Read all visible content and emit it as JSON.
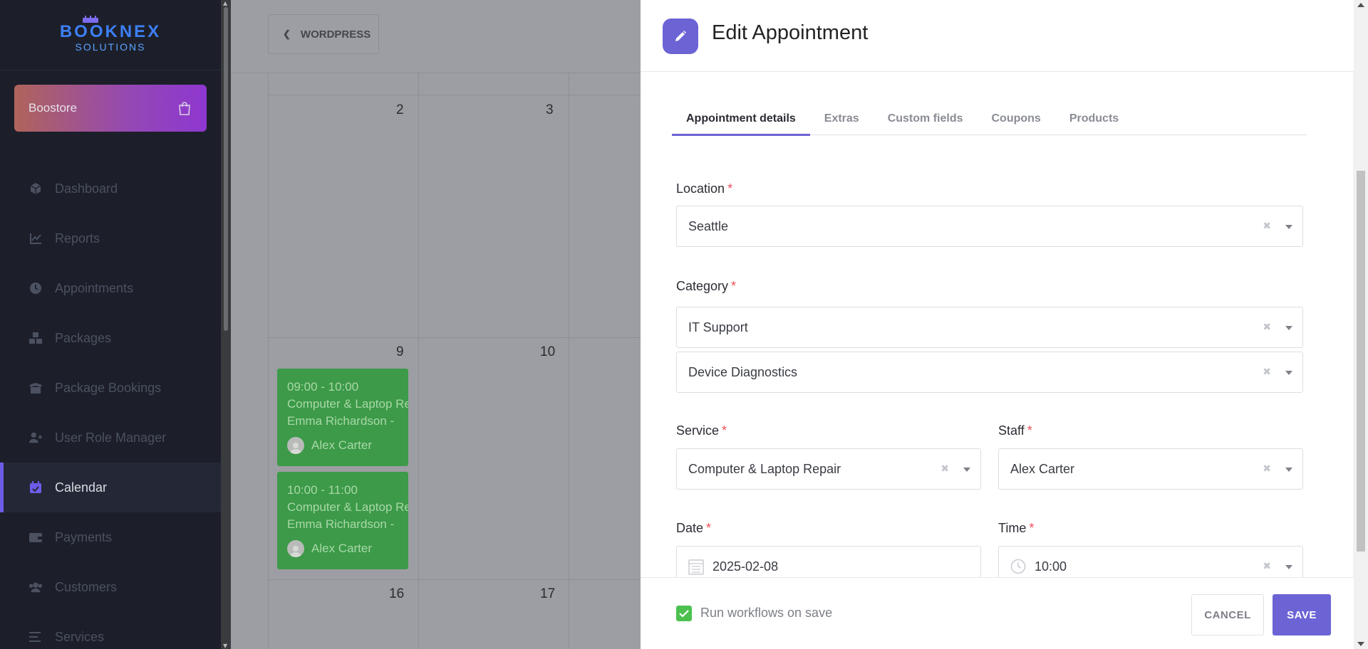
{
  "brand": {
    "name": "BOOKNEX",
    "tagline": "SOLUTIONS"
  },
  "boostore": {
    "label": "Boostore",
    "icon": "shopping-bag-icon"
  },
  "sidebar": {
    "items": [
      {
        "label": "Dashboard",
        "icon": "cube-icon"
      },
      {
        "label": "Reports",
        "icon": "chart-line-icon"
      },
      {
        "label": "Appointments",
        "icon": "clock-icon"
      },
      {
        "label": "Packages",
        "icon": "boxes-icon"
      },
      {
        "label": "Package Bookings",
        "icon": "box-open-icon"
      },
      {
        "label": "User Role Manager",
        "icon": "user-plus-icon"
      },
      {
        "label": "Calendar",
        "icon": "calendar-check-icon",
        "active": true
      },
      {
        "label": "Payments",
        "icon": "wallet-icon"
      },
      {
        "label": "Customers",
        "icon": "users-icon"
      },
      {
        "label": "Services",
        "icon": "list-icon"
      }
    ]
  },
  "background": {
    "back_button": "WORDPRESS",
    "days": [
      "2",
      "3",
      "9",
      "10",
      "16",
      "17"
    ],
    "events": [
      {
        "time": "09:00 - 10:00",
        "service": "Computer & Laptop Repair",
        "customer": "Emma Richardson -",
        "staff": "Alex Carter"
      },
      {
        "time": "10:00 - 11:00",
        "service": "Computer & Laptop Repair",
        "customer": "Emma Richardson -",
        "staff": "Alex Carter"
      }
    ]
  },
  "modal": {
    "title": "Edit Appointment",
    "tabs": [
      "Appointment details",
      "Extras",
      "Custom fields",
      "Coupons",
      "Products"
    ],
    "active_tab": "Appointment details",
    "fields": {
      "location": {
        "label": "Location",
        "value": "Seattle"
      },
      "category": {
        "label": "Category",
        "value": "IT Support",
        "subvalue": "Device Diagnostics"
      },
      "service": {
        "label": "Service",
        "value": "Computer & Laptop Repair"
      },
      "staff": {
        "label": "Staff",
        "value": "Alex Carter"
      },
      "date": {
        "label": "Date",
        "value": "2025-02-08"
      },
      "time": {
        "label": "Time",
        "value": "10:00"
      }
    },
    "required_mark": "*",
    "footer": {
      "run_workflows_label": "Run workflows on save",
      "run_workflows_checked": true,
      "cancel_label": "CANCEL",
      "save_label": "SAVE"
    }
  },
  "colors": {
    "accent": "#6c63d5",
    "sidebar_bg": "#1c1f2a",
    "event_green": "#3c9a48",
    "required_red": "#ef4f5a",
    "checkbox_green": "#4cc04f"
  }
}
